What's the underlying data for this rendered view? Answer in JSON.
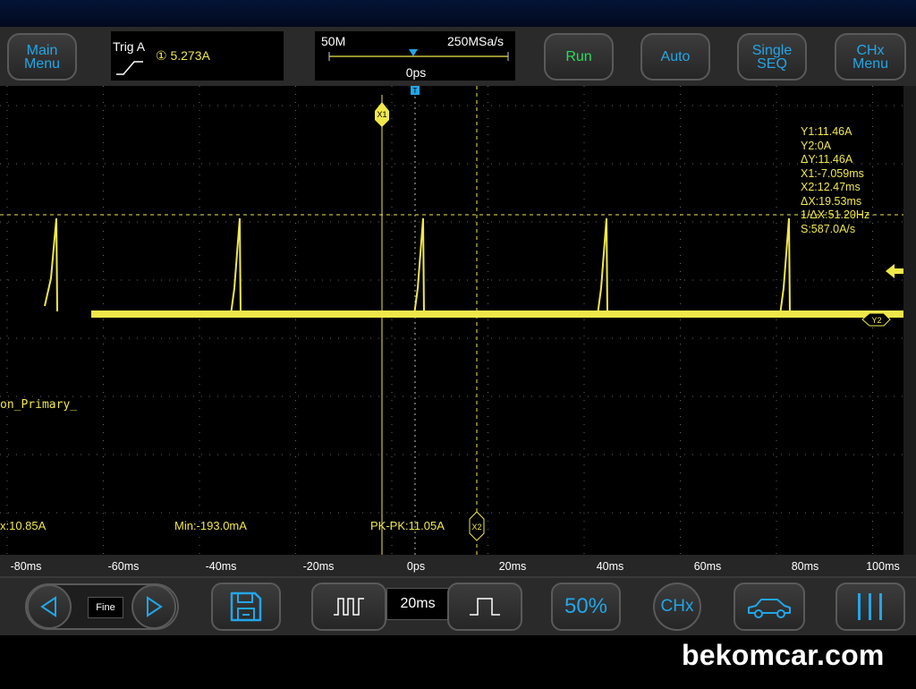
{
  "toolbar": {
    "main_menu": "Main\nMenu",
    "run": "Run",
    "auto": "Auto",
    "single_seq": "Single\nSEQ",
    "chx_menu": "CHx\nMenu"
  },
  "trigger": {
    "title": "Trig A",
    "value": "① 5.273A"
  },
  "timebase": {
    "memory_depth": "50M",
    "sample_rate": "250MSa/s",
    "position": "0ps"
  },
  "channel": {
    "label": "on_Primary_",
    "color": "#f0e84a"
  },
  "markers": {
    "x1": "X1",
    "x2": "X2",
    "y2": "Y2",
    "trigger": "T"
  },
  "cursors": [
    "Y1:11.46A",
    "Y2:0A",
    "ΔY:11.46A",
    "X1:-7.059ms",
    "X2:12.47ms",
    "ΔX:19.53ms",
    "1/ΔX:51.20Hz",
    "S:587.0A/s"
  ],
  "measurements": {
    "max": "x:10.85A",
    "min": "Min:-193.0mA",
    "pkpk": "PK-PK:11.05A"
  },
  "time_axis": [
    "-80ms",
    "-60ms",
    "-40ms",
    "-20ms",
    "0ps",
    "20ms",
    "40ms",
    "60ms",
    "80ms",
    "100ms"
  ],
  "bottom": {
    "fine": "Fine",
    "time_div": "20ms",
    "fifty": "50%",
    "chx": "CHx",
    "prev_icon": "triangle-left-icon",
    "next_icon": "triangle-right-icon",
    "save_icon": "floppy-save-icon",
    "car_icon": "car-icon",
    "bars_icon": "three-bars-icon"
  },
  "watermark": "bekomcar.com"
}
